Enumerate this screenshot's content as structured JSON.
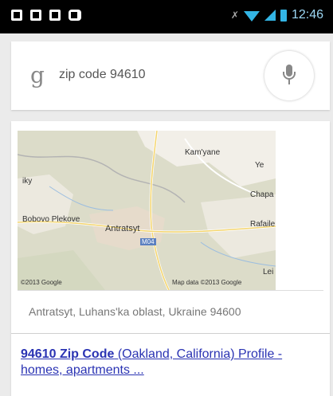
{
  "status_bar": {
    "time": "12:46",
    "icons": [
      "notification-icon",
      "notification-icon",
      "notification-icon",
      "game-controller-icon",
      "no-sim-icon",
      "wifi-icon",
      "cell-signal-icon",
      "battery-icon"
    ]
  },
  "search": {
    "query": "zip code 94610",
    "logo_glyph": "g"
  },
  "map": {
    "labels": {
      "town": "Antratsyt",
      "kamyane": "Kam'yane",
      "yes": "Ye",
      "chapa": "Chapa",
      "ratele": "Rafaile",
      "bobovo": "Bobovo Plekove",
      "iky": "iky",
      "road": "M04",
      "les": "Lei",
      "attribution_left": "©2013 Google",
      "attribution_right": "Map data ©2013 Google"
    }
  },
  "result": {
    "address": "Antratsyt, Luhans'ka oblast, Ukraine 94600",
    "link_bold": "94610 Zip Code",
    "link_rest": " (Oakland, California) Profile - homes, apartments ..."
  }
}
